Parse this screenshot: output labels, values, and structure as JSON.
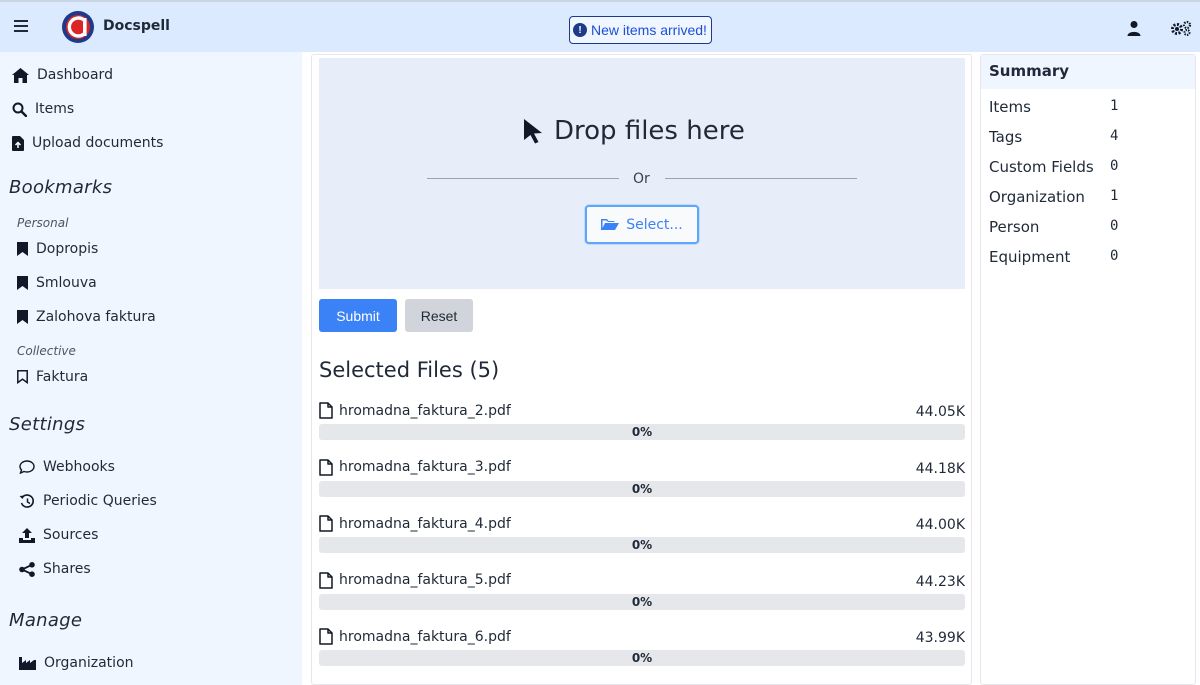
{
  "app": {
    "name": "Docspell",
    "notice": "New items arrived!"
  },
  "sidebar": {
    "main": [
      {
        "label": "Dashboard",
        "icon": "home-icon"
      },
      {
        "label": "Items",
        "icon": "search-icon"
      },
      {
        "label": "Upload documents",
        "icon": "file-upload-icon"
      }
    ],
    "bookmarks_title": "Bookmarks",
    "personal_label": "Personal",
    "personal": [
      "Dopropis",
      "Smlouva",
      "Zalohova faktura"
    ],
    "collective_label": "Collective",
    "collective": [
      "Faktura"
    ],
    "settings_title": "Settings",
    "settings": [
      {
        "label": "Webhooks",
        "icon": "comment-icon"
      },
      {
        "label": "Periodic Queries",
        "icon": "history-icon"
      },
      {
        "label": "Sources",
        "icon": "upload-icon"
      },
      {
        "label": "Shares",
        "icon": "share-icon"
      }
    ],
    "manage_title": "Manage",
    "manage": [
      {
        "label": "Organization",
        "icon": "industry-icon"
      }
    ]
  },
  "upload": {
    "drop_title": "Drop files here",
    "or": "Or",
    "select_label": "Select...",
    "submit_label": "Submit",
    "reset_label": "Reset",
    "files_title": "Selected Files (5)",
    "files": [
      {
        "name": "hromadna_faktura_2.pdf",
        "size": "44.05K",
        "progress": "0%",
        "progress_value": 0
      },
      {
        "name": "hromadna_faktura_3.pdf",
        "size": "44.18K",
        "progress": "0%",
        "progress_value": 0
      },
      {
        "name": "hromadna_faktura_4.pdf",
        "size": "44.00K",
        "progress": "0%",
        "progress_value": 0
      },
      {
        "name": "hromadna_faktura_5.pdf",
        "size": "44.23K",
        "progress": "0%",
        "progress_value": 0
      },
      {
        "name": "hromadna_faktura_6.pdf",
        "size": "43.99K",
        "progress": "0%",
        "progress_value": 0
      }
    ]
  },
  "summary": {
    "title": "Summary",
    "rows": [
      {
        "label": "Items",
        "value": "1"
      },
      {
        "label": "Tags",
        "value": "4"
      },
      {
        "label": "Custom Fields",
        "value": "0"
      },
      {
        "label": "Organization",
        "value": "1"
      },
      {
        "label": "Person",
        "value": "0"
      },
      {
        "label": "Equipment",
        "value": "0"
      }
    ]
  },
  "colors": {
    "accent": "#3b82f6",
    "topbar": "#dbeafe",
    "sidebar": "#f0f6ff",
    "logo_red": "#dc2626",
    "logo_navy": "#1e3a8a"
  }
}
